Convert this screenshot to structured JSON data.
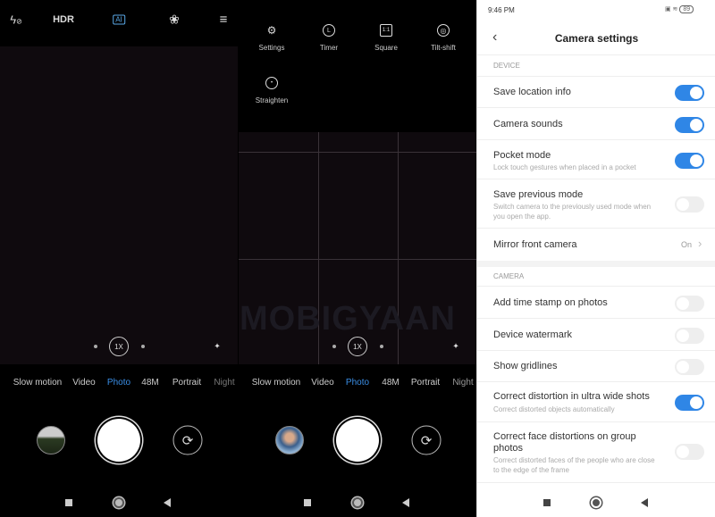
{
  "left_camera": {
    "top_icons": [
      "flash-off-icon",
      "HDR",
      "AI",
      "filters-icon",
      "menu-icon"
    ],
    "hdr_label": "HDR",
    "ai_label": "AI",
    "zoom": "1X",
    "modes": [
      "Slow motion",
      "Video",
      "Photo",
      "48M",
      "Portrait",
      "Night"
    ],
    "active_mode": "Photo"
  },
  "right_camera": {
    "menu": [
      {
        "label": "Settings",
        "icon": "gear-icon"
      },
      {
        "label": "Timer",
        "icon": "clock-icon"
      },
      {
        "label": "Square",
        "icon": "square-ratio-icon",
        "glyph": "1:1"
      },
      {
        "label": "Tilt-shift",
        "icon": "tilt-shift-icon"
      },
      {
        "label": "Straighten",
        "icon": "straighten-icon"
      }
    ],
    "zoom": "1X",
    "modes": [
      "Slow motion",
      "Video",
      "Photo",
      "48M",
      "Portrait",
      "Night"
    ],
    "active_mode": "Photo",
    "watermark": "MOBIGYAAN"
  },
  "settings": {
    "status_time": "9:46 PM",
    "battery": "89",
    "title": "Camera settings",
    "device_section": "DEVICE",
    "device_items": [
      {
        "title": "Save location info",
        "on": true
      },
      {
        "title": "Camera sounds",
        "on": true
      },
      {
        "title": "Pocket mode",
        "subtitle": "Lock touch gestures when placed in a pocket",
        "on": true
      },
      {
        "title": "Save previous mode",
        "subtitle": "Switch camera to the previously used mode when you open the app.",
        "on": false
      },
      {
        "title": "Mirror front camera",
        "value": "On"
      }
    ],
    "camera_section": "CAMERA",
    "camera_items": [
      {
        "title": "Add time stamp on photos",
        "on": false
      },
      {
        "title": "Device watermark",
        "on": false
      },
      {
        "title": "Show gridlines",
        "on": false
      },
      {
        "title": "Correct distortion in ultra wide shots",
        "subtitle": "Correct distorted objects automatically",
        "on": true
      },
      {
        "title": "Correct face distortions on group photos",
        "subtitle": "Correct distorted faces of the people who are close to the edge of the frame",
        "on": false
      }
    ]
  },
  "colors": {
    "accent": "#2f86e6",
    "active_mode": "#3a8ee6",
    "toggle_off": "#eeeeee"
  }
}
